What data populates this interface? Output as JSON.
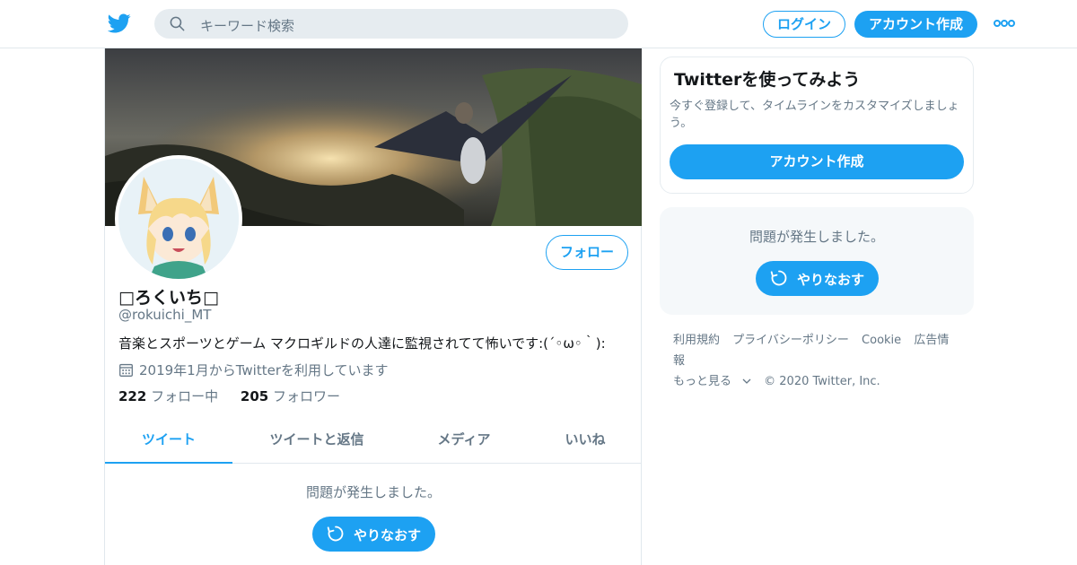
{
  "header": {
    "logo_icon": "twitter-bird-icon",
    "search_placeholder": "キーワード検索",
    "login_label": "ログイン",
    "signup_label": "アカウント作成",
    "more_icon": "more-dots-icon",
    "accent_color": "#1da1f2"
  },
  "profile": {
    "display_name": "□ろくいち□",
    "handle": "@rokuichi_MT",
    "bio": "音楽とスポーツとゲーム マクロギルドの人達に監視されてて怖いです:(´◦ω◦｀):",
    "joined": "2019年1月からTwitterを利用しています",
    "following_count": "222",
    "following_label": "フォロー中",
    "followers_count": "205",
    "followers_label": "フォロワー",
    "follow_label": "フォロー"
  },
  "tabs": [
    {
      "label": "ツイート",
      "active": true
    },
    {
      "label": "ツイートと返信",
      "active": false
    },
    {
      "label": "メディア",
      "active": false
    },
    {
      "label": "いいね",
      "active": false
    }
  ],
  "main_error": {
    "message": "問題が発生しました。",
    "retry_label": "やりなおす"
  },
  "sidebar": {
    "card_title": "Twitterを使ってみよう",
    "card_desc": "今すぐ登録して、タイムラインをカスタマイズしましょう。",
    "card_button": "アカウント作成",
    "error_message": "問題が発生しました。",
    "retry_label": "やりなおす"
  },
  "footer": {
    "links": [
      "利用規約",
      "プライバシーポリシー",
      "Cookie",
      "広告情報"
    ],
    "more_label": "もっと見る",
    "copyright": "© 2020 Twitter, Inc."
  }
}
